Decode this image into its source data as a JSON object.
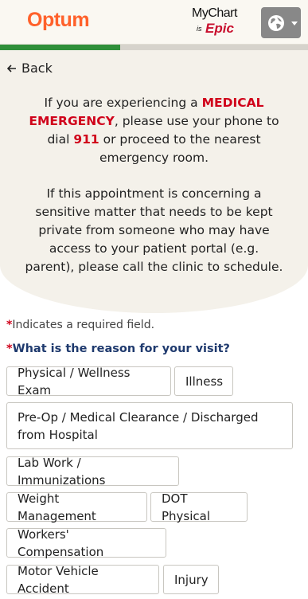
{
  "header": {
    "optum_logo": "Optum",
    "mychart_logo": {
      "line1": "MyChart",
      "is": "is",
      "epic": "Epic"
    },
    "language_icon": "globe-icon"
  },
  "progress": {
    "fraction": 0.39,
    "fill_color": "#2f8f3a",
    "track_color": "#d6d3cc"
  },
  "notice": {
    "back": "Back",
    "p1_a": "If you are experiencing a ",
    "p1_red1": "MEDICAL EMERGENCY",
    "p1_b": ", please use your phone to dial ",
    "p1_red2": "911",
    "p1_c": " or proceed to the nearest emergency room.",
    "p2": "If this appointment is concerning a sensitive matter that needs to be kept private from someone who may have access to your patient portal (e.g. parent), please call the clinic to schedule."
  },
  "form": {
    "required_star": "*",
    "required_note": "Indicates a required field.",
    "question": "What is the reason for your visit?",
    "options": [
      "Physical / Wellness Exam",
      "Illness",
      "Pre-Op / Medical Clearance / Discharged from Hospital",
      "Lab Work / Immunizations",
      "Weight Management",
      "DOT Physical",
      "Workers' Compensation",
      "Motor Vehicle Accident",
      "Injury"
    ]
  },
  "colors": {
    "optum_orange": "#ff612b",
    "emergency_red": "#d0021b",
    "question_blue": "#1f3a6e",
    "epic_red": "#c8102e"
  }
}
